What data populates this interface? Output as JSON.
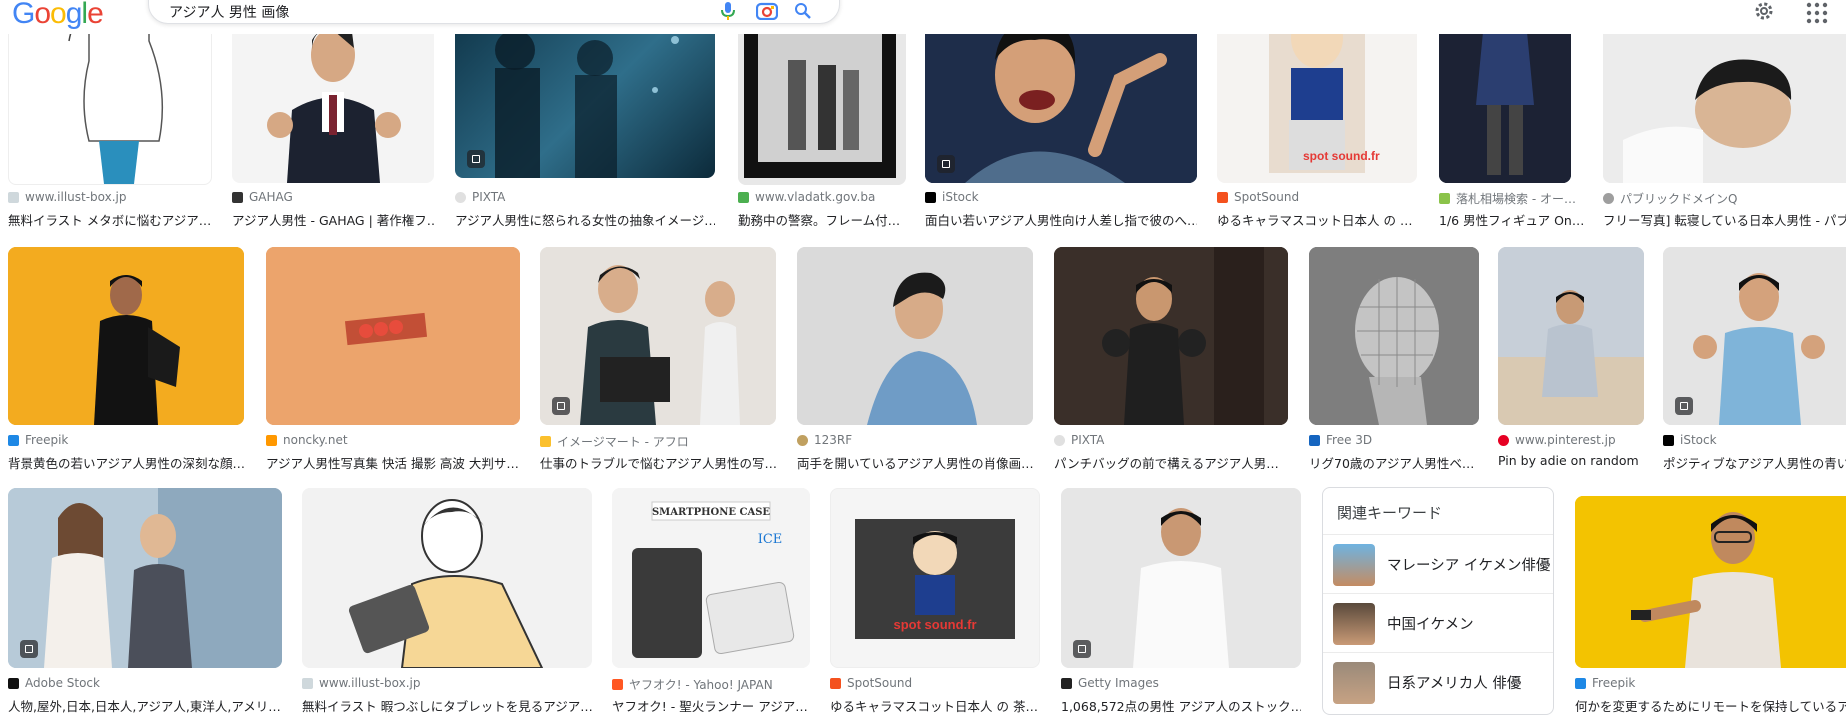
{
  "header": {
    "logo": "Google",
    "search_query": "アジア人 男性 画像",
    "icons": [
      "mic-icon",
      "camera-icon",
      "search-icon",
      "gear-icon",
      "apps-icon"
    ]
  },
  "row1": [
    {
      "source": "www.illust-box.jp",
      "title": "無料イラスト メタボに悩むアジア…"
    },
    {
      "source": "GAHAG",
      "title": "アジア人男性 - GAHAG | 著作権フ…"
    },
    {
      "source": "PIXTA",
      "title": "アジア人男性に怒られる女性の抽象イメージ…"
    },
    {
      "source": "www.vladatk.gov.ba",
      "title": "勤務中の警察。フレーム付…"
    },
    {
      "source": "iStock",
      "title": "面白い若いアジア人男性向け人差し指で彼のへ…"
    },
    {
      "source": "SpotSound",
      "title": "ゆるキャラマスコット日本人 の …"
    },
    {
      "source": "落札相場検索 - オー…",
      "title": "1/6 男性フィギュア On…"
    },
    {
      "source": "パブリックドメインQ",
      "title": "フリー写真] 転寝している日本人男性 - パブリ"
    }
  ],
  "row2": [
    {
      "source": "Freepik",
      "title": "背景黄色の若いアジア人男性の深刻な顔…"
    },
    {
      "source": "noncky.net",
      "title": "アジア人男性写真集 快活 撮影 高波 大判サ…"
    },
    {
      "source": "イメージマート - アフロ",
      "title": "仕事のトラブルで悩むアジア人男性の写…"
    },
    {
      "source": "123RF",
      "title": "両手を開いているアジア人男性の肖像画…"
    },
    {
      "source": "PIXTA",
      "title": "パンチバッグの前で構えるアジア人男…"
    },
    {
      "source": "Free 3D",
      "title": "リグ70歳のアジア人男性ベ…"
    },
    {
      "source": "www.pinterest.jp",
      "title": "Pin by adie on random |…"
    },
    {
      "source": "iStock",
      "title": "ポジティブなアジア人男性の青い"
    }
  ],
  "row3": [
    {
      "source": "Adobe Stock",
      "title": "人物,屋外,日本,日本人,アジア人,東洋人,アメリ…"
    },
    {
      "source": "www.illust-box.jp",
      "title": "無料イラスト 暇つぶしにタブレットを見るアジア…"
    },
    {
      "source": "ヤフオク! - Yahoo! JAPAN",
      "title": "ヤフオク! - 聖火ランナー アジア…"
    },
    {
      "source": "SpotSound",
      "title": "ゆるキャラマスコット日本人 の 茶…"
    },
    {
      "source": "Getty Images",
      "title": "1,068,572点の男性 アジア人のストック…"
    },
    {
      "source": "Freepik",
      "title": "何かを変更するためにリモートを保持しているア"
    }
  ],
  "related": {
    "heading": "関連キーワード",
    "items": [
      "マレーシア イケメン俳優",
      "中国イケメン",
      "日系アメリカ人 俳優"
    ]
  },
  "overlay_text": {
    "smartphone_case": "SMARTPHONE CASE",
    "ice": "ICE",
    "spot_sound": "spot sound.fr"
  }
}
